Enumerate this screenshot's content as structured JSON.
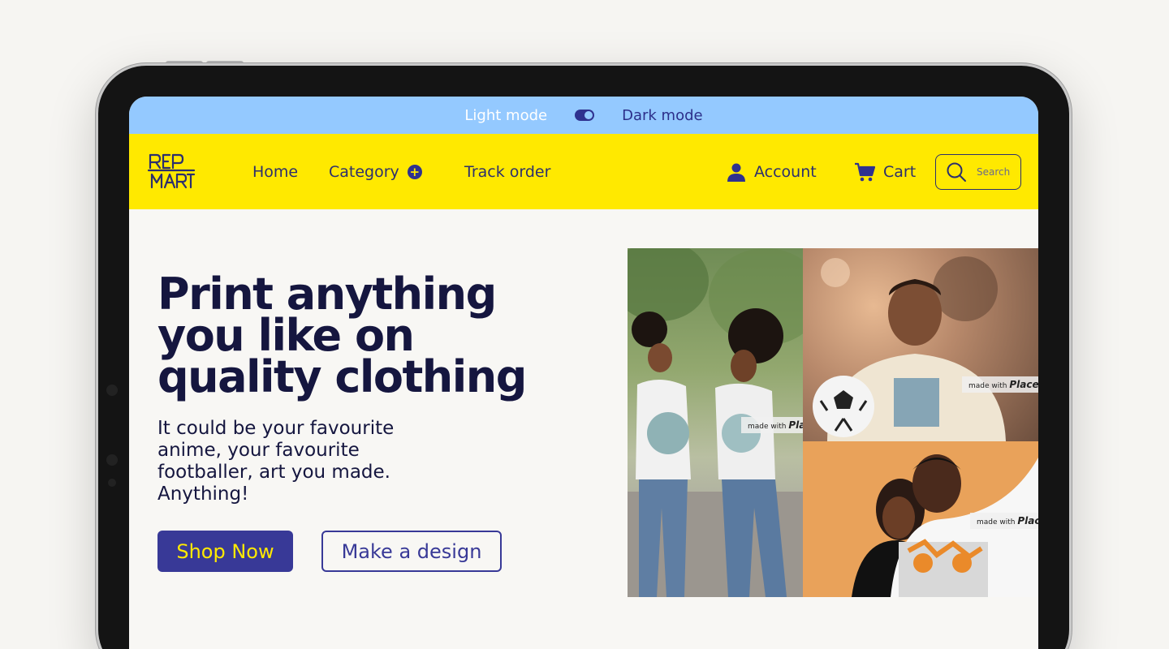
{
  "mode_bar": {
    "light_label": "Light mode",
    "dark_label": "Dark mode"
  },
  "header": {
    "logo_text": "REP MART",
    "nav": {
      "home": "Home",
      "category": "Category",
      "track_order": "Track order",
      "account": "Account",
      "cart": "Cart"
    },
    "search": {
      "placeholder": "Search"
    }
  },
  "hero": {
    "title": "Print anything you like on quality clothing",
    "subtitle": "It could be your favourite anime, your favourite footballer, art you made. Anything!",
    "primary_button": "Shop Now",
    "secondary_button": "Make a design"
  },
  "gallery": {
    "watermark_prefix": "made with",
    "watermark_brand": "Placeit",
    "watermark_cut": "Plac"
  },
  "colors": {
    "mode_bar": "#94c9ff",
    "nav_bar": "#ffe900",
    "primary": "#383997",
    "heading": "#15163f"
  }
}
